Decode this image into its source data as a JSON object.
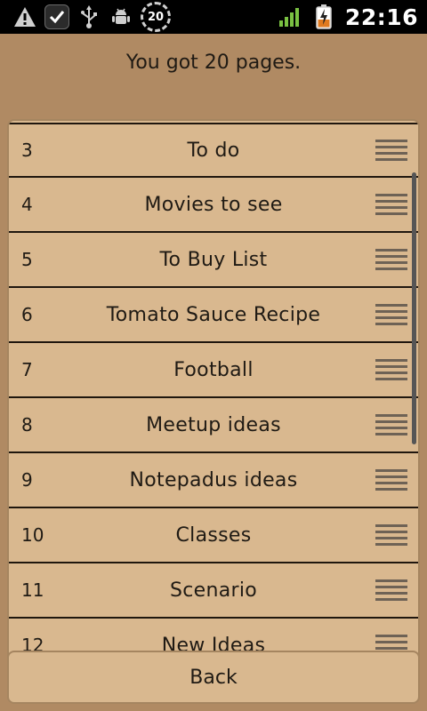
{
  "statusbar": {
    "timer_badge": "20",
    "clock": "22:16",
    "icons": [
      "warning-icon",
      "task-check-icon",
      "usb-icon",
      "android-debug-icon",
      "timer-icon",
      "signal-icon",
      "battery-charging-icon"
    ]
  },
  "header": {
    "text": "You got 20 pages."
  },
  "pages": [
    {
      "num": "3",
      "title": "To do"
    },
    {
      "num": "4",
      "title": "Movies to see"
    },
    {
      "num": "5",
      "title": "To Buy List"
    },
    {
      "num": "6",
      "title": "Tomato Sauce Recipe"
    },
    {
      "num": "7",
      "title": "Football"
    },
    {
      "num": "8",
      "title": "Meetup ideas"
    },
    {
      "num": "9",
      "title": "Notepadus ideas"
    },
    {
      "num": "10",
      "title": "Classes"
    },
    {
      "num": "11",
      "title": "Scenario"
    },
    {
      "num": "12",
      "title": "New Ideas"
    }
  ],
  "back_button": {
    "label": "Back"
  },
  "colors": {
    "wallpaper": "#b08a63",
    "panel": "#d9b88f",
    "border": "#1f160e"
  }
}
